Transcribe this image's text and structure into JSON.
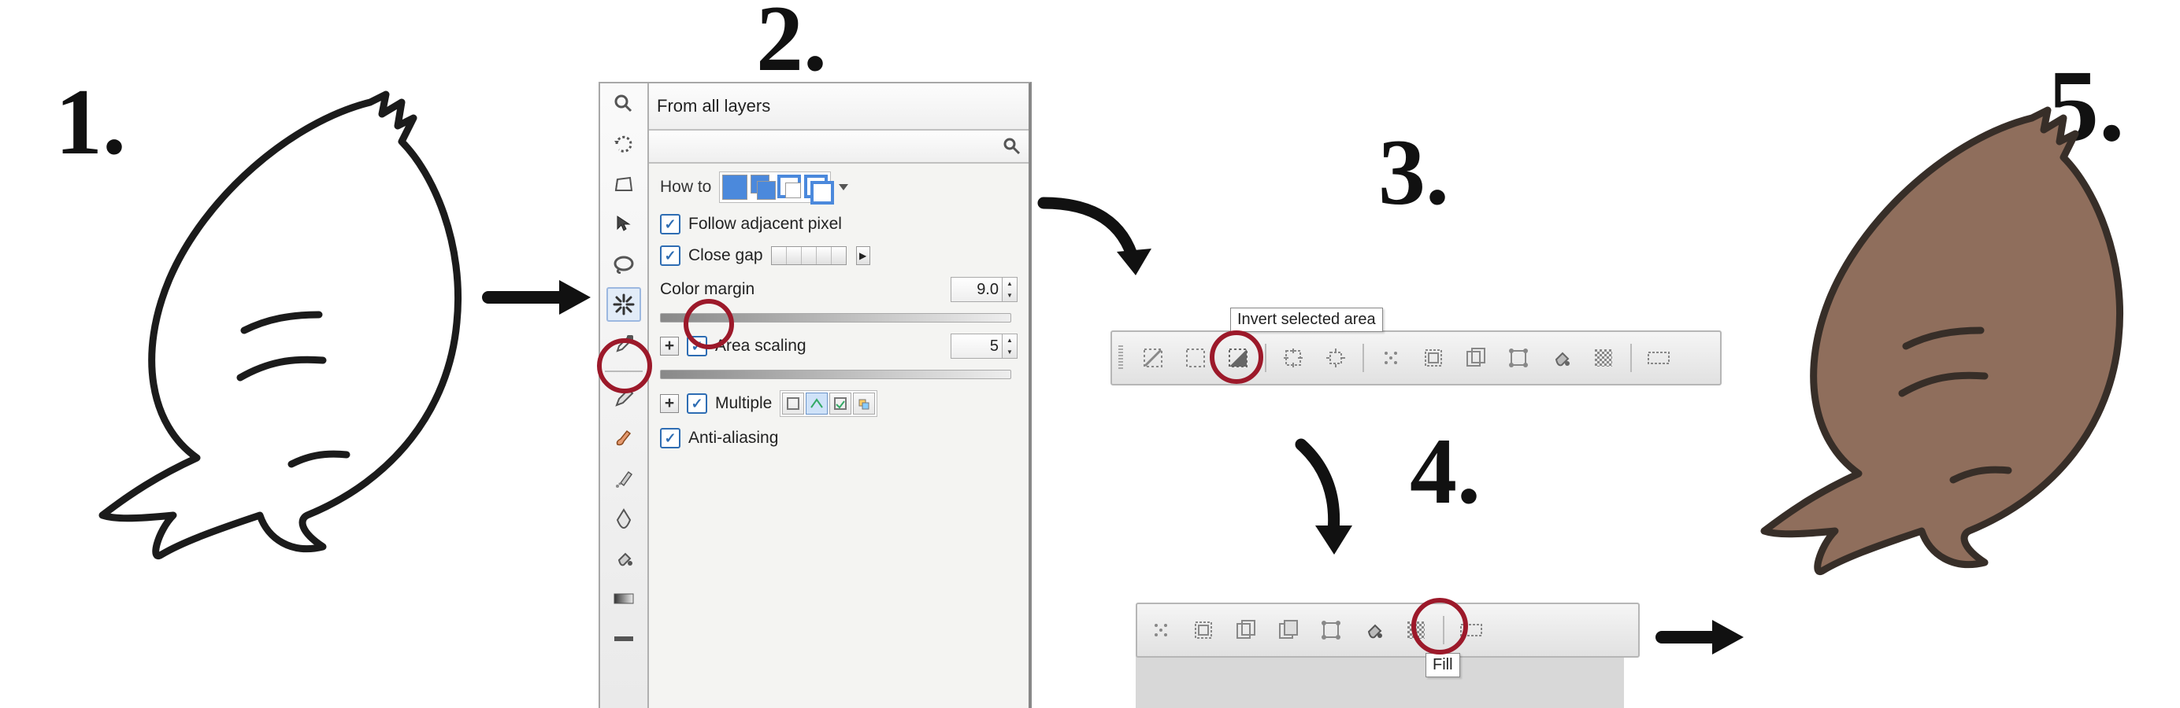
{
  "steps": {
    "n1": "1.",
    "n2": "2.",
    "n3": "3.",
    "n4": "4.",
    "n5": "5."
  },
  "panel": {
    "header": "From all layers",
    "howto": "How to",
    "follow": "Follow adjacent pixel",
    "closegap": "Close gap",
    "colormargin": "Color margin",
    "colormargin_val": "9.0",
    "areascaling": "Area scaling",
    "areascaling_val": "5",
    "multi": "Multiple",
    "aa": "Anti-aliasing"
  },
  "tooltips": {
    "invert": "Invert selected area",
    "fill": "Fill"
  }
}
